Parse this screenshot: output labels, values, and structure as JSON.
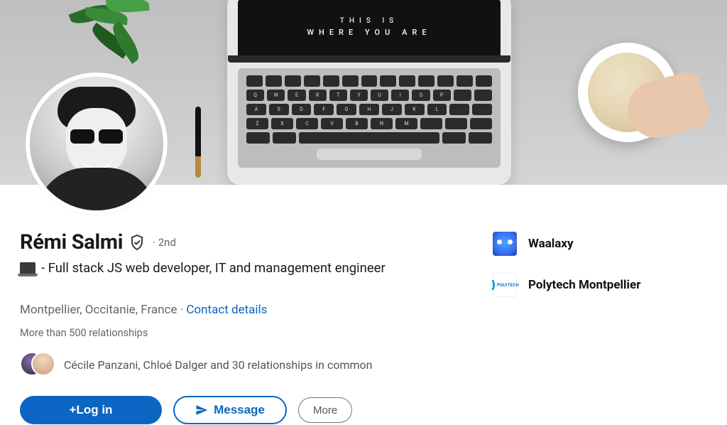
{
  "cover": {
    "screen_line1": "THIS IS",
    "screen_line2": "WHERE YOU ARE"
  },
  "profile": {
    "name": "Rémi Salmi",
    "degree": "· 2nd",
    "headline": "- Full stack JS web developer, IT and management engineer",
    "location": "Montpellier, Occitanie, France",
    "contact_label": "Contact details",
    "relationship_count": "More than 500 relationships",
    "mutual_text": "Cécile Panzani, Chloé Dalger and 30 relationships in common"
  },
  "actions": {
    "login": "+Log in",
    "message": "Message",
    "more": "More"
  },
  "orgs": [
    {
      "name": "Waalaxy",
      "logo": "waalaxy"
    },
    {
      "name": "Polytech Montpellier",
      "logo": "polytech",
      "logo_text": "POLYTECH"
    }
  ]
}
